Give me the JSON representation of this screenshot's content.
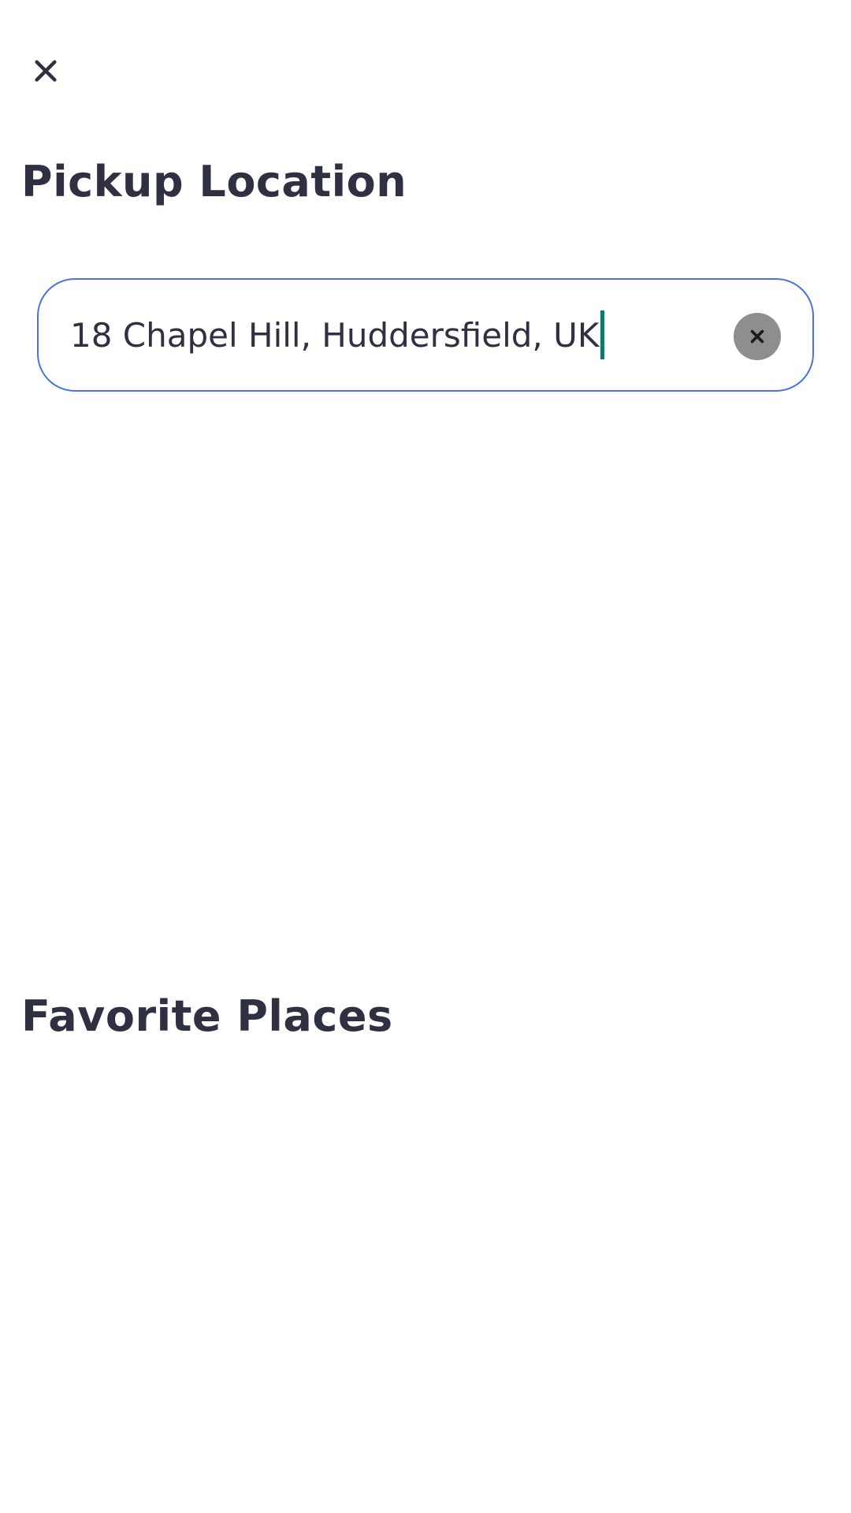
{
  "header": {
    "close_icon": "close-icon",
    "title": "Pickup Location"
  },
  "search": {
    "value": "18 Chapel Hill, Huddersfield, UK",
    "clear_icon": "clear-icon",
    "border_color": "#4a72e6",
    "caret_color": "#0e7b69"
  },
  "favorites": {
    "title": "Favorite Places"
  }
}
